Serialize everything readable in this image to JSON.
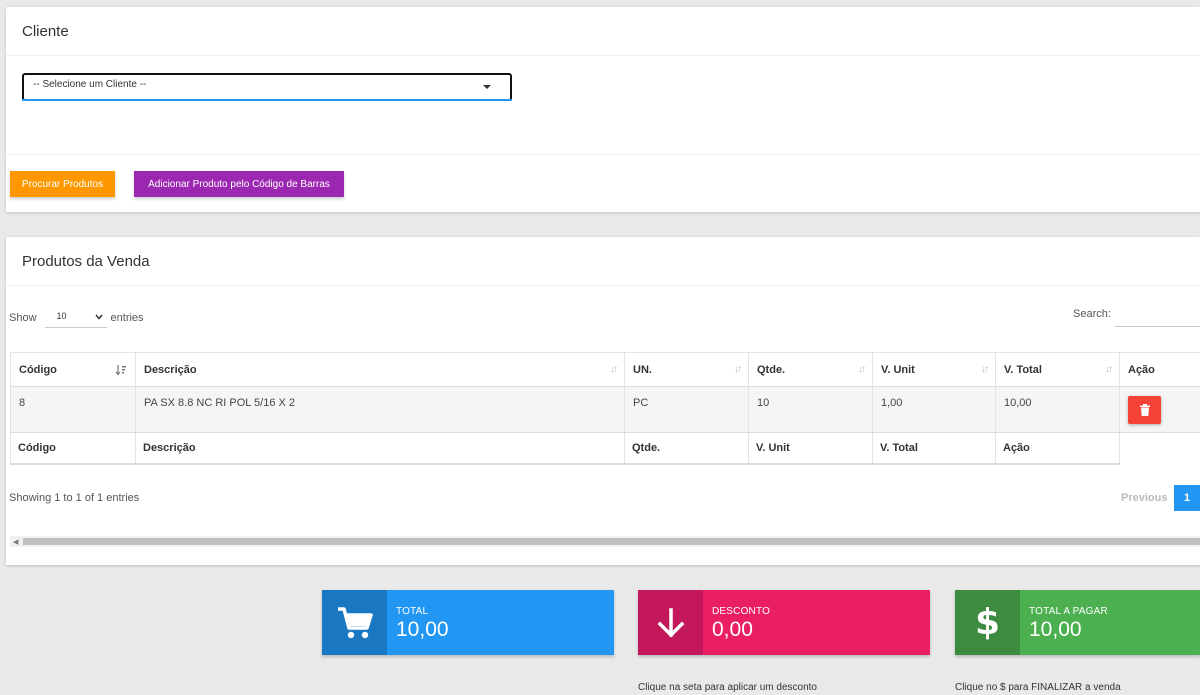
{
  "cliente": {
    "title": "Cliente",
    "select_value": "-- Selecione um Cliente --",
    "btn_procurar": "Procurar Produtos",
    "btn_barras": "Adicionar Produto pelo Código de Barras"
  },
  "produtos": {
    "title": "Produtos da Venda",
    "show_label": "Show",
    "length_value": "10",
    "entries_label": "entries",
    "search_label": "Search:",
    "columns": [
      "Código",
      "Descrição",
      "UN.",
      "Qtde.",
      "V. Unit",
      "V. Total",
      "Ação"
    ],
    "rows": [
      {
        "codigo": "8",
        "descricao": "PA SX 8.8 NC RI POL 5/16 X 2",
        "un": "PC",
        "qtde": "10",
        "vunit": "1,00",
        "vtotal": "10,00"
      }
    ],
    "footer_columns": [
      "Código",
      "Descrição",
      "Qtde.",
      "V. Unit",
      "V. Total",
      "Ação"
    ],
    "info": "Showing 1 to 1 of 1 entries",
    "prev": "Previous",
    "page": "1"
  },
  "totals": {
    "total_label": "TOTAL",
    "total_value": "10,00",
    "desconto_label": "DESCONTO",
    "desconto_value": "0,00",
    "desconto_hint": "Clique na seta para aplicar um desconto",
    "pagar_label": "TOTAL A PAGAR",
    "pagar_value": "10,00",
    "pagar_hint": "Clique no $ para FINALIZAR a venda"
  },
  "colors": {
    "total": "#2196f3",
    "desconto": "#e91e63",
    "pagar": "#4caf50",
    "procurar": "#ff9800",
    "barras": "#9c27b0",
    "delete": "#f44336"
  },
  "icons": {
    "total": "shopping-cart-icon",
    "desconto": "arrow-down-icon",
    "pagar": "dollar-icon",
    "delete": "trash-icon"
  }
}
